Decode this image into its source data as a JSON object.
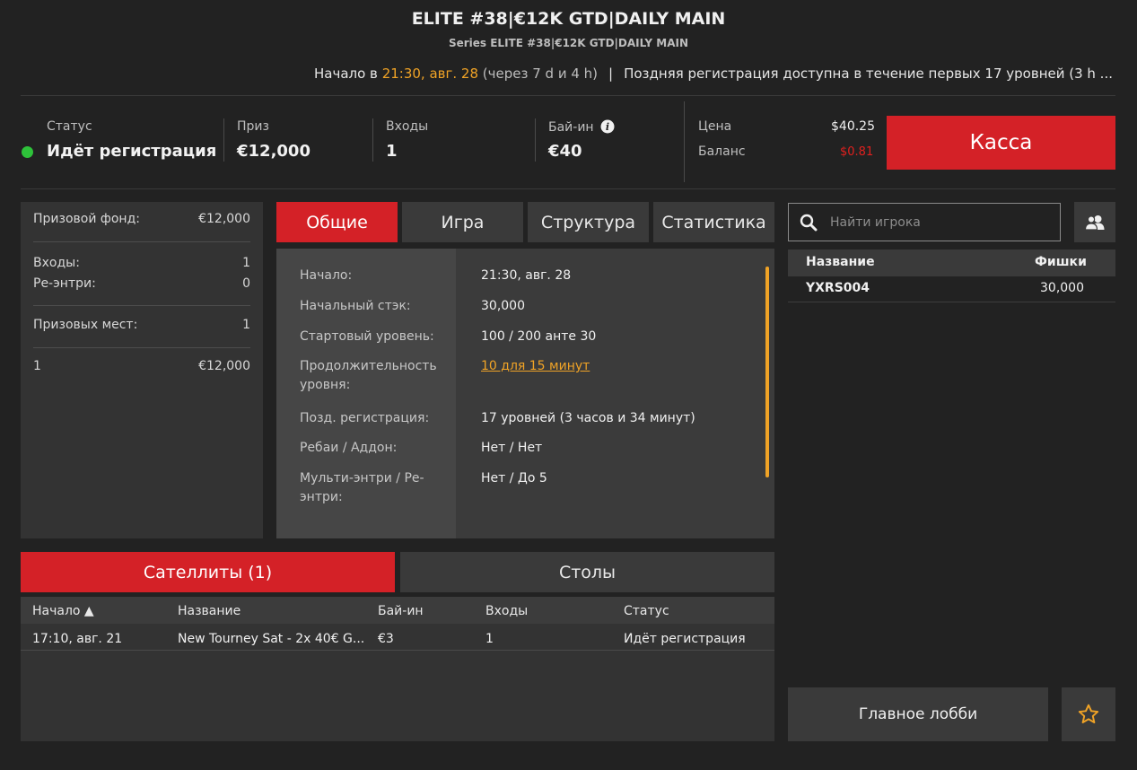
{
  "header": {
    "title": "ELITE #38|€12K GTD|DAILY MAIN",
    "subtitle": "Series ELITE #38|€12K GTD|DAILY MAIN",
    "start_prefix": "Начало в",
    "start_time": "21:30, авг. 28",
    "start_relative": "(через 7 d и 4 h)",
    "separator": "|",
    "late_reg": "Поздняя регистрация доступна в течение первых 17 уровней (3 h ..."
  },
  "stats": {
    "status_label": "Статус",
    "status_value": "Идёт регистрация",
    "prize_label": "Приз",
    "prize_value": "€12,000",
    "entries_label": "Входы",
    "entries_value": "1",
    "buyin_label": "Бай-ин",
    "buyin_value": "€40",
    "price_label": "Цена",
    "price_value": "$40.25",
    "balance_label": "Баланс",
    "balance_value": "$0.81",
    "cashier_label": "Касса"
  },
  "colors": {
    "accent_red": "#d42127",
    "highlight_orange": "#f0a326",
    "status_green": "#2ec23a",
    "balance_red": "#e0201e"
  },
  "prize_panel": {
    "pool_label": "Призовой фонд:",
    "pool_value": "€12,000",
    "entries_label": "Входы:",
    "entries_value": "1",
    "reentries_label": "Ре-энтри:",
    "reentries_value": "0",
    "places_label": "Призовых мест:",
    "places_value": "1",
    "payouts": [
      {
        "place": "1",
        "amount": "€12,000"
      }
    ]
  },
  "tabs": {
    "items": [
      {
        "label": "Общие",
        "active": true
      },
      {
        "label": "Игра",
        "active": false
      },
      {
        "label": "Структура",
        "active": false
      },
      {
        "label": "Статистика",
        "active": false
      }
    ]
  },
  "details": {
    "rows": [
      {
        "label": "Начало:",
        "value": "21:30, авг. 28"
      },
      {
        "label": "Начальный стэк:",
        "value": "30,000"
      },
      {
        "label": "Стартовый уровень:",
        "value": "100 / 200 анте 30"
      },
      {
        "label": "Продолжительность уровня:",
        "value": "10 для 15 минут"
      },
      {
        "label": "Позд. регистрация:",
        "value": "17 уровней (3 часов и 34 минут)"
      },
      {
        "label": "Ребаи / Аддон:",
        "value": "Нет / Нет"
      },
      {
        "label": "Мульти-энтри / Ре-энтри:",
        "value": "Нет / До 5"
      }
    ]
  },
  "players": {
    "search_placeholder": "Найти игрока",
    "col_name": "Название",
    "col_chips": "Фишки",
    "rows": [
      {
        "name": "YXRS004",
        "chips": "30,000"
      }
    ]
  },
  "bottom_tabs": {
    "satellites_label": "Сателлиты (1)",
    "tables_label": "Столы"
  },
  "satellites": {
    "columns": [
      "Начало ▲",
      "Название",
      "Бай-ин",
      "Входы",
      "Статус"
    ],
    "rows": [
      {
        "start": "17:10, авг. 21",
        "name": "New Tourney Sat - 2x 40€ G...",
        "buyin": "€3",
        "entries": "1",
        "status": "Идёт регистрация"
      }
    ]
  },
  "footer": {
    "lobby_label": "Главное лобби"
  }
}
